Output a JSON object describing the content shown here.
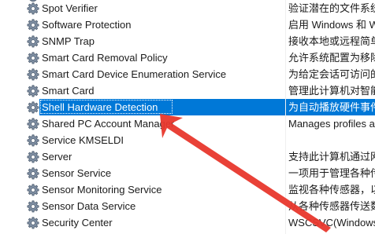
{
  "services": [
    {
      "name": "Spot Verifier",
      "description": "验证潜在的文件系统",
      "selected": false
    },
    {
      "name": "Software Protection",
      "description": "启用 Windows 和 W",
      "selected": false
    },
    {
      "name": "SNMP Trap",
      "description": "接收本地或远程简单",
      "selected": false
    },
    {
      "name": "Smart Card Removal Policy",
      "description": "允许系统配置为移除",
      "selected": false
    },
    {
      "name": "Smart Card Device Enumeration Service",
      "description": "为给定会话可访问的",
      "selected": false
    },
    {
      "name": "Smart Card",
      "description": "管理此计算机对智能",
      "selected": false
    },
    {
      "name": "Shell Hardware Detection",
      "description": "为自动播放硬件事件",
      "selected": true
    },
    {
      "name": "Shared PC Account Manager",
      "description": "Manages profiles a",
      "selected": false
    },
    {
      "name": "Service KMSELDI",
      "description": "",
      "selected": false
    },
    {
      "name": "Server",
      "description": "支持此计算机通过网",
      "selected": false
    },
    {
      "name": "Sensor Service",
      "description": "一项用于管理各种传感",
      "selected": false
    },
    {
      "name": "Sensor Monitoring Service",
      "description": "监视各种传感器，以",
      "selected": false
    },
    {
      "name": "Sensor Data Service",
      "description": "从各种传感器传送数",
      "selected": false
    },
    {
      "name": "Security Center",
      "description": "WSCSVC(Windows",
      "selected": false
    }
  ],
  "colors": {
    "selection": "#0078d7",
    "arrow": "#e8372c",
    "gear": "#6f7f92"
  },
  "icons": {
    "service": "gear-icon",
    "annotation": "red-arrow"
  }
}
